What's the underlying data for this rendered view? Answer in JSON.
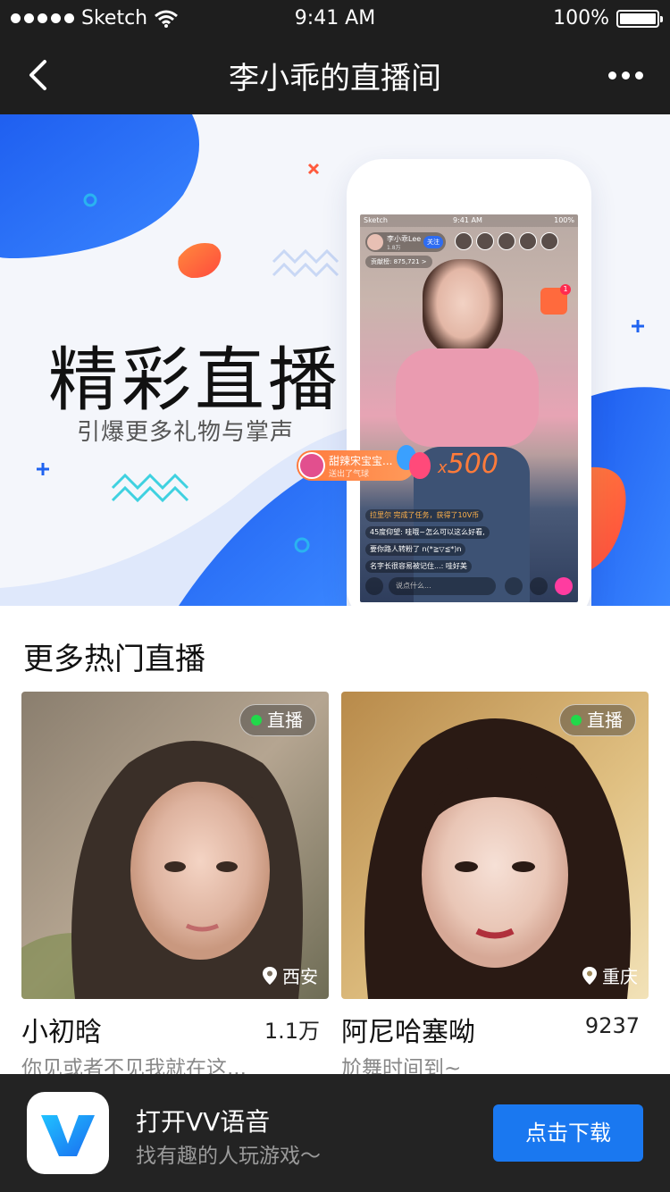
{
  "status_bar": {
    "carrier": "Sketch",
    "time": "9:41 AM",
    "battery": "100%"
  },
  "nav": {
    "title": "李小乖的直播间"
  },
  "banner": {
    "headline": "精彩直播",
    "subhead": "引爆更多礼物与掌声",
    "phone": {
      "status_carrier": "Sketch",
      "status_time": "9:41 AM",
      "status_battery": "100%",
      "streamer_name": "李小乖Lee",
      "streamer_fans": "1.8万",
      "follow_label": "关注",
      "contribution": "贡献榜: 875,721 >",
      "chat": [
        "拉里尔 完成了任务，获得了10V币",
        "45度仰望: 哇哦~怎么可以这么好看,",
        "要你路人转粉了 n(*≧▽≦*)n",
        "名字长很容易被记住...: 哇好美"
      ],
      "input_placeholder": "说点什么..."
    },
    "gift": {
      "sender": "甜辣宋宝宝...",
      "action": "送出了气球",
      "combo_prefix": "x",
      "combo_count": "500"
    }
  },
  "section": {
    "title": "更多热门直播"
  },
  "cards": [
    {
      "live_label": "直播",
      "location": "西安",
      "name": "小初晗",
      "count": "1.1万",
      "desc": "你见或者不见我就在这..."
    },
    {
      "live_label": "直播",
      "location": "重庆",
      "name": "阿尼哈塞呦",
      "count": "9237",
      "desc": "尬舞时间到~"
    }
  ],
  "download_bar": {
    "title": "打开VV语音",
    "subtitle": "找有趣的人玩游戏～",
    "button": "点击下载"
  },
  "colors": {
    "accent_blue": "#1a78f0",
    "banner_blue": "#2a6af0",
    "orange": "#ff6a3d",
    "live_green": "#21d94a"
  },
  "icons": [
    "wifi-icon",
    "battery-icon",
    "back-chevron-icon",
    "more-dots-icon",
    "location-pin-icon",
    "vv-logo-icon"
  ]
}
